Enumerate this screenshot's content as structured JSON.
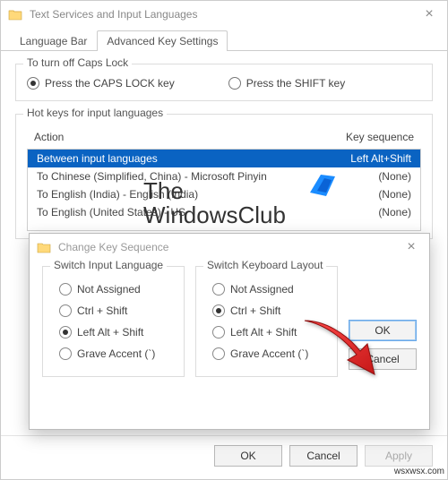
{
  "main": {
    "title": "Text Services and Input Languages",
    "tabs": [
      "Language Bar",
      "Advanced Key Settings"
    ],
    "active_tab": 1,
    "group_capslock": {
      "label": "To turn off Caps Lock",
      "opt1": "Press the CAPS LOCK key",
      "opt2": "Press the SHIFT key",
      "selected": 0
    },
    "group_hotkeys": {
      "label": "Hot keys for input languages",
      "col_action": "Action",
      "col_seq": "Key sequence",
      "rows": [
        {
          "action": "Between input languages",
          "seq": "Left Alt+Shift",
          "selected": true
        },
        {
          "action": "To Chinese (Simplified, China) - Microsoft Pinyin",
          "seq": "(None)"
        },
        {
          "action": "To English (India) - English (India)",
          "seq": "(None)"
        },
        {
          "action": "To English (United States) - US",
          "seq": "(None)"
        }
      ]
    },
    "footer": {
      "ok": "OK",
      "cancel": "Cancel",
      "apply": "Apply"
    }
  },
  "dialog": {
    "title": "Change Key Sequence",
    "left": {
      "label": "Switch Input Language",
      "opts": [
        "Not Assigned",
        "Ctrl + Shift",
        "Left Alt + Shift",
        "Grave Accent (`)"
      ],
      "selected": 2
    },
    "right": {
      "label": "Switch Keyboard Layout",
      "opts": [
        "Not Assigned",
        "Ctrl + Shift",
        "Left Alt + Shift",
        "Grave Accent (`)"
      ],
      "selected": 1
    },
    "ok": "OK",
    "cancel": "Cancel"
  },
  "watermark": {
    "line1": "The",
    "line2": "WindowsClub"
  },
  "sitemark": "wsxwsx.com"
}
